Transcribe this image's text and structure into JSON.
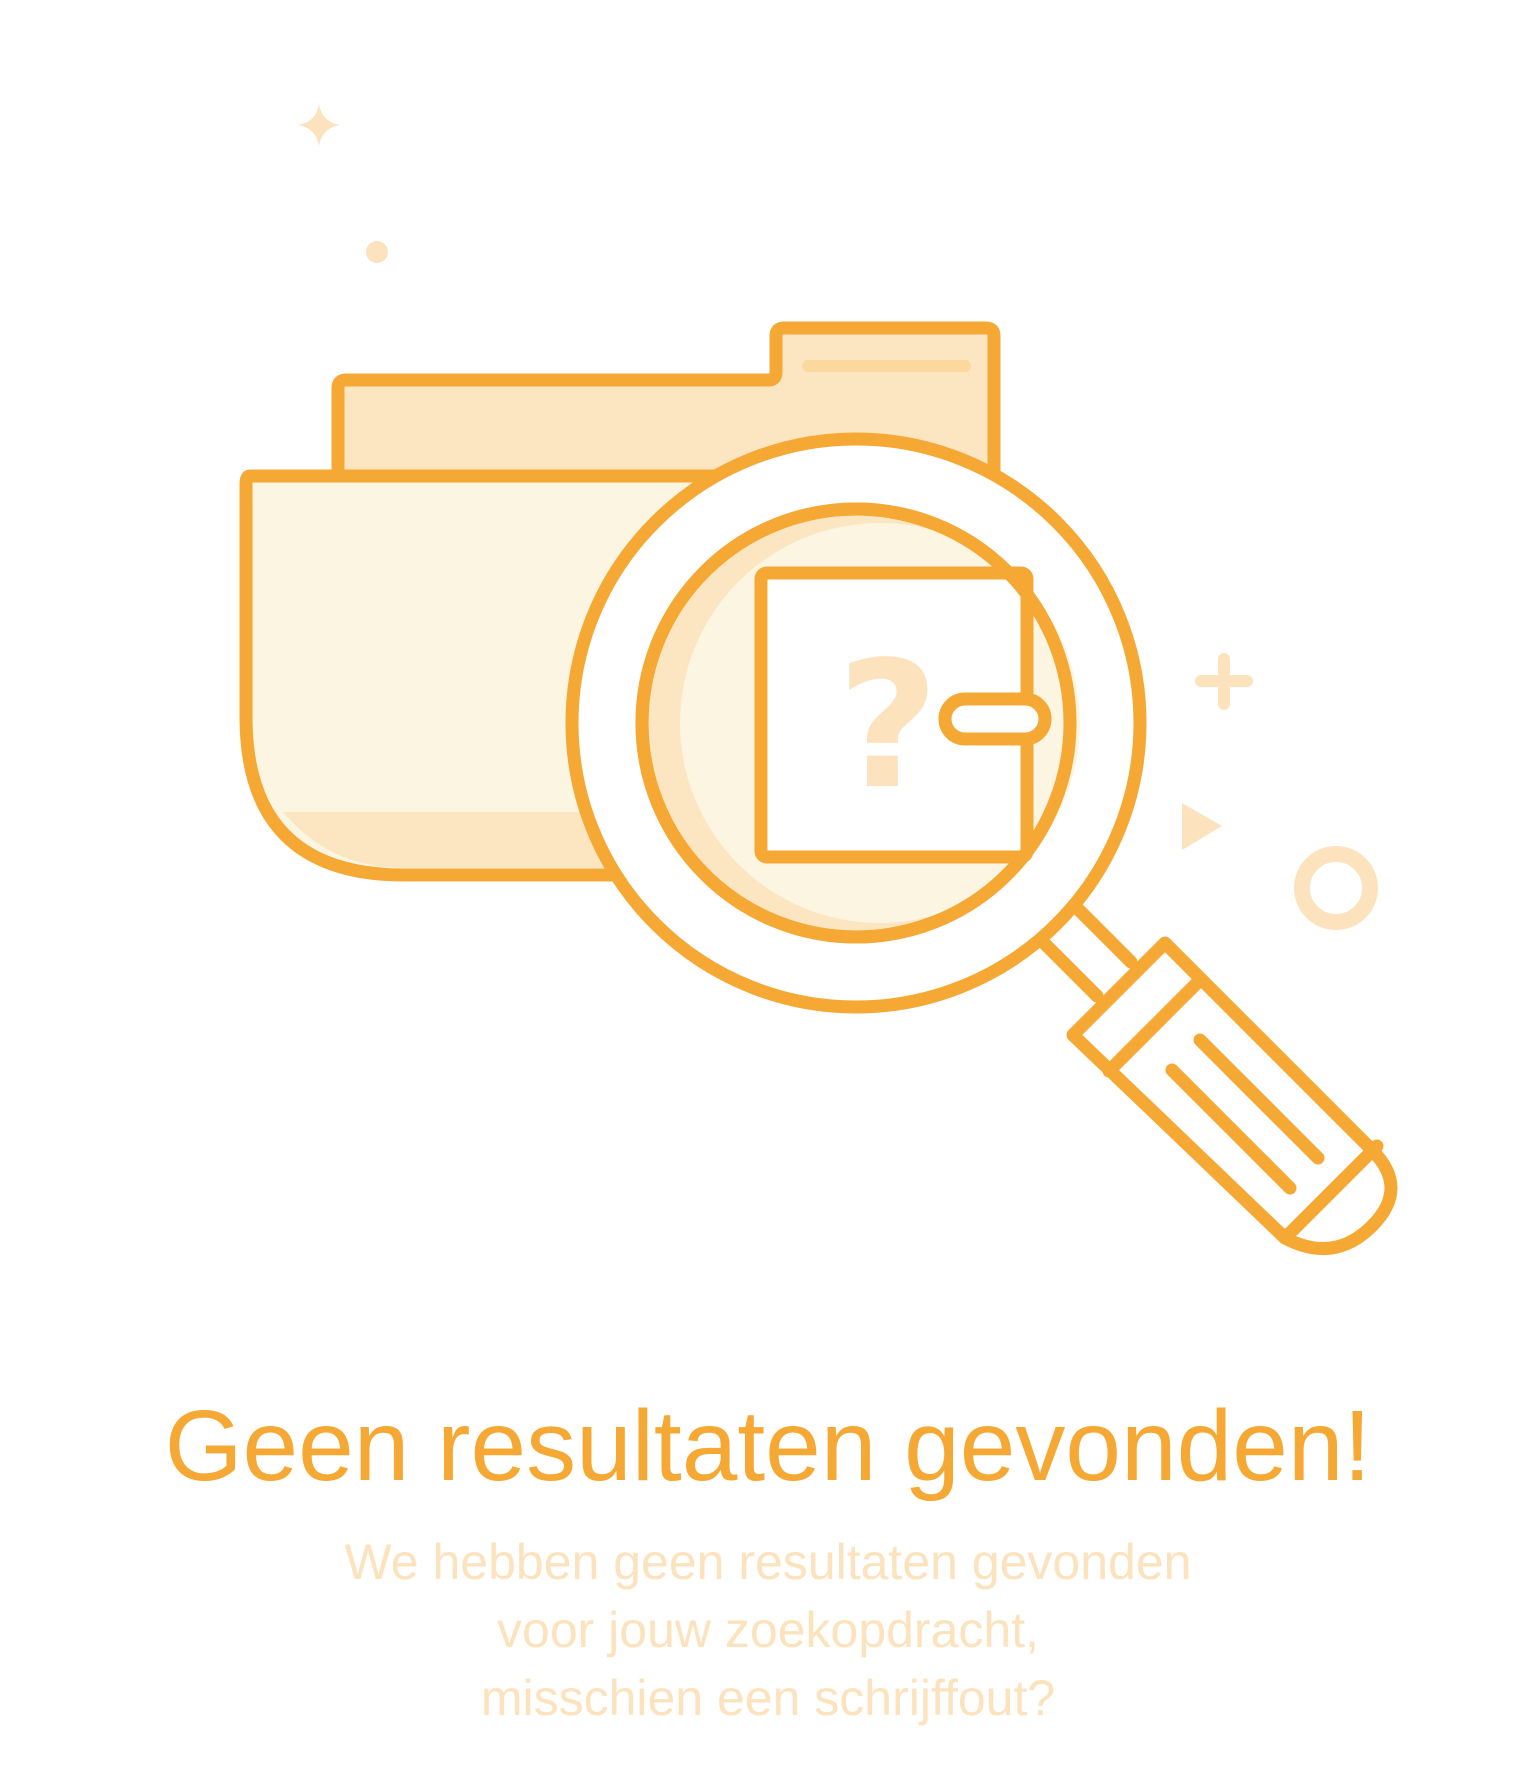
{
  "empty_state": {
    "illustration_icon": "folder-search-icon",
    "title": "Geen resultaten gevonden!",
    "message_lines": [
      "We hebben geen resultaten gevonden",
      "voor jouw zoekopdracht,",
      "misschien een schrijffout?"
    ]
  },
  "colors": {
    "accent": "#F5A833",
    "accent_light": "#FCE5C0",
    "fill_light": "#FCF5E1",
    "text_muted": "#FCE3BE",
    "background": "#FFFFFF"
  }
}
